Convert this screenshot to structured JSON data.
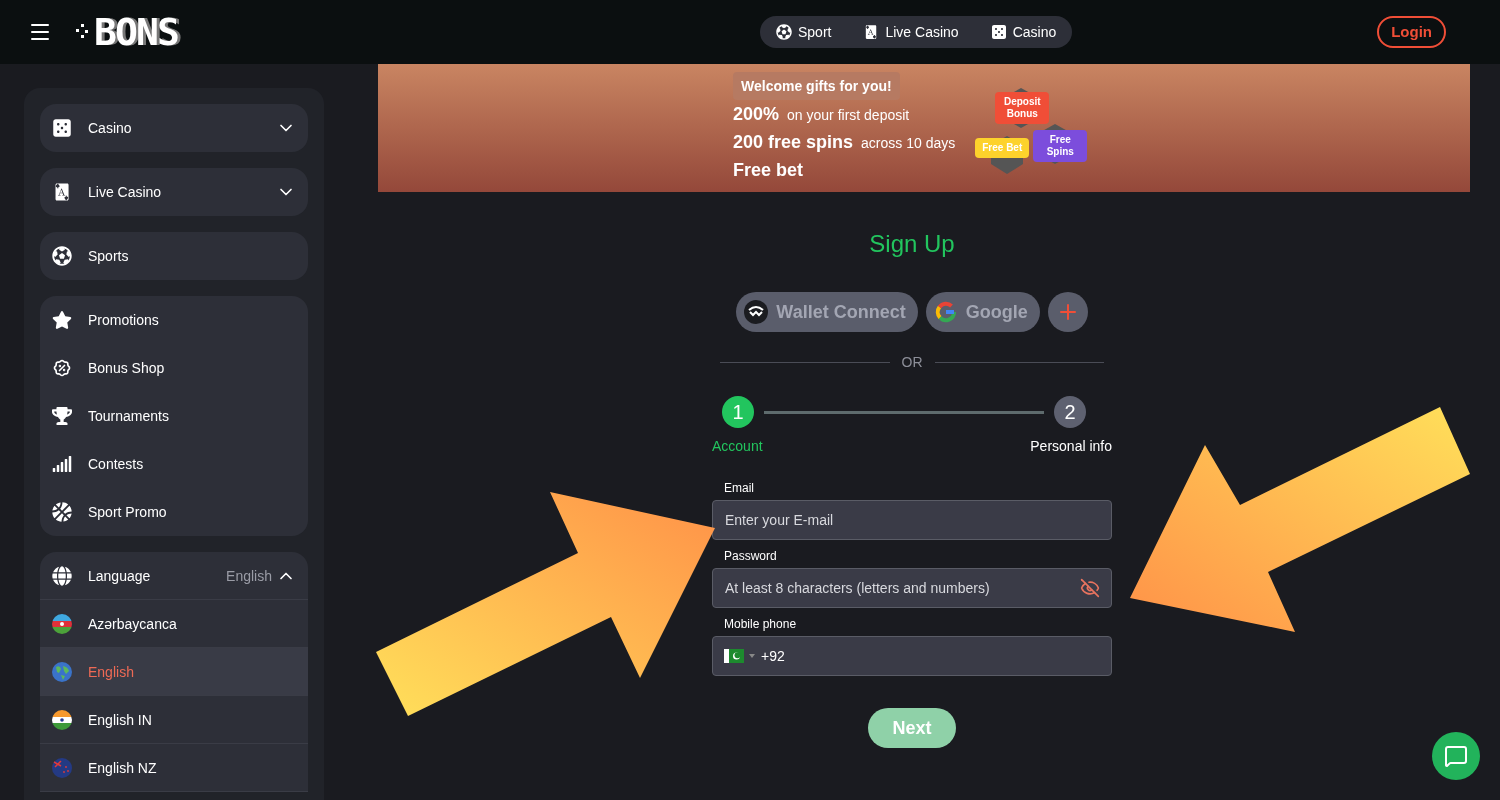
{
  "header": {
    "logo": "BONS",
    "nav": [
      {
        "label": "Sport",
        "kind": "soccer"
      },
      {
        "label": "Live Casino",
        "kind": "cards"
      },
      {
        "label": "Casino",
        "kind": "slots"
      }
    ],
    "login": "Login"
  },
  "sidebar": {
    "top": [
      {
        "label": "Casino",
        "kind": "slots",
        "expanded": false
      },
      {
        "label": "Live Casino",
        "kind": "cards",
        "expanded": false
      },
      {
        "label": "Sports",
        "kind": "soccer"
      }
    ],
    "links": [
      {
        "label": "Promotions",
        "kind": "star"
      },
      {
        "label": "Bonus Shop",
        "kind": "bonus"
      },
      {
        "label": "Tournaments",
        "kind": "trophy"
      },
      {
        "label": "Contests",
        "kind": "steps"
      },
      {
        "label": "Sport Promo",
        "kind": "basketball"
      }
    ],
    "language": {
      "label": "Language",
      "value": "English",
      "expanded": true,
      "options": [
        {
          "label": "Azərbaycanca",
          "kind": "az",
          "selected": false
        },
        {
          "label": "English",
          "kind": "world",
          "selected": true
        },
        {
          "label": "English IN",
          "kind": "in",
          "selected": false
        },
        {
          "label": "English NZ",
          "kind": "nz",
          "selected": false
        }
      ]
    }
  },
  "banner": {
    "title": "Welcome gifts for you!",
    "lines": [
      {
        "strong": "200%",
        "rest": "on your first deposit"
      },
      {
        "strong": "200 free spins",
        "rest": "across 10 days"
      },
      {
        "strong": "Free bet"
      }
    ],
    "tags": [
      {
        "label": "Deposit Bonus",
        "color": "#f04e37"
      },
      {
        "label": "Free Bet",
        "color": "#fdd22c"
      },
      {
        "label": "Free Spins",
        "color": "#7c4ddc"
      }
    ]
  },
  "signup": {
    "title": "Sign Up",
    "social": [
      {
        "label": "Wallet Connect",
        "kind": "walletconnect"
      },
      {
        "label": "Google",
        "kind": "google"
      },
      {
        "kind": "more"
      }
    ],
    "divider": "OR",
    "steps": [
      {
        "number": "1",
        "label": "Account",
        "active": true
      },
      {
        "number": "2",
        "label": "Personal info",
        "active": false
      }
    ],
    "email": {
      "label": "Email",
      "placeholder": "Enter your E-mail"
    },
    "password": {
      "label": "Password",
      "placeholder": "At least 8 characters (letters and numbers)"
    },
    "phone": {
      "label": "Mobile phone",
      "value": "+92"
    },
    "next": "Next"
  }
}
